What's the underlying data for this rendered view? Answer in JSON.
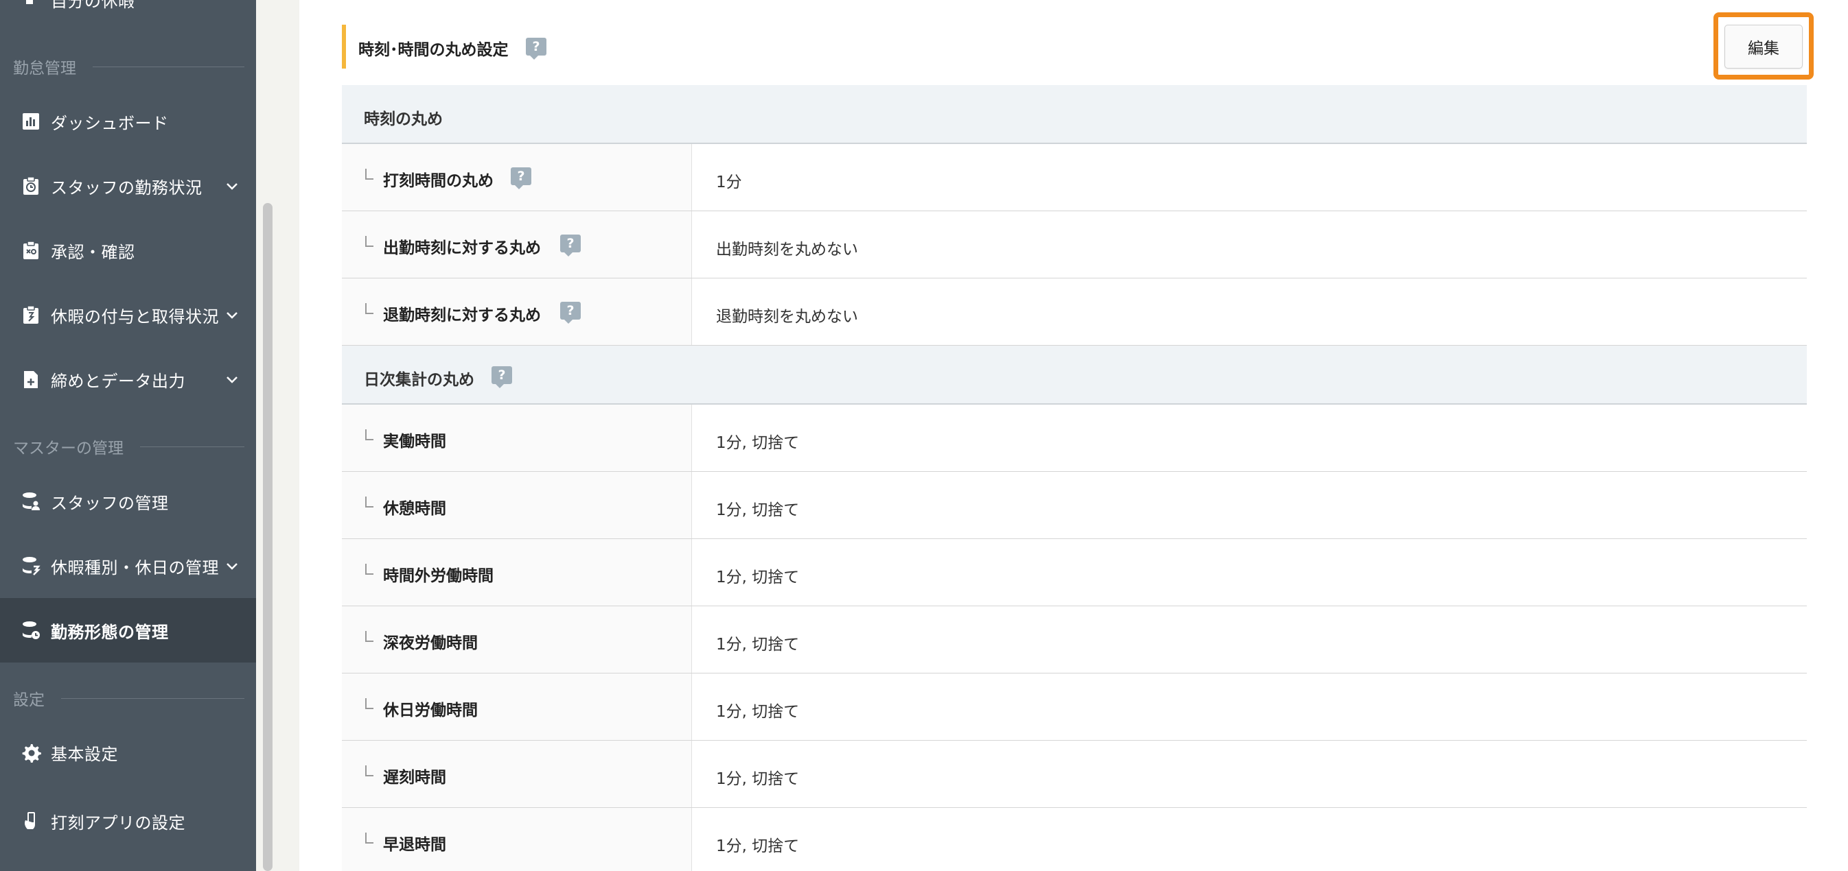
{
  "sidebar": {
    "top_partial_label": "自分の休暇",
    "sections": [
      {
        "label": "勤怠管理"
      },
      {
        "label": "マスターの管理"
      },
      {
        "label": "設定"
      }
    ],
    "items": [
      {
        "label": "ダッシュボード",
        "icon": "chart-icon"
      },
      {
        "label": "スタッフの勤務状況",
        "icon": "clock-clipboard-icon",
        "has_submenu": true
      },
      {
        "label": "承認・確認",
        "icon": "approval-clipboard-icon"
      },
      {
        "label": "休暇の付与と取得状況",
        "icon": "leave-clipboard-icon",
        "has_submenu": true
      },
      {
        "label": "締めとデータ出力",
        "icon": "file-export-icon",
        "has_submenu": true
      },
      {
        "label": "スタッフの管理",
        "icon": "database-user-icon"
      },
      {
        "label": "休暇種別・休日の管理",
        "icon": "database-leave-icon",
        "has_submenu": true
      },
      {
        "label": "勤務形態の管理",
        "icon": "database-clock-icon",
        "active": true
      },
      {
        "label": "基本設定",
        "icon": "gear-icon"
      },
      {
        "label": "打刻アプリの設定",
        "icon": "phone-hand-icon"
      }
    ]
  },
  "main": {
    "section_title": "時刻･時間の丸め設定",
    "help_glyph": "?",
    "edit_button_label": "編集",
    "groups": [
      {
        "title": "時刻の丸め",
        "rows": [
          {
            "label": "打刻時間の丸め",
            "value": "1分"
          },
          {
            "label": "出勤時刻に対する丸め",
            "value": "出勤時刻を丸めない"
          },
          {
            "label": "退勤時刻に対する丸め",
            "value": "退勤時刻を丸めない"
          }
        ]
      },
      {
        "title": "日次集計の丸め",
        "rows": [
          {
            "label": "実働時間",
            "value": "1分, 切捨て"
          },
          {
            "label": "休憩時間",
            "value": "1分, 切捨て"
          },
          {
            "label": "時間外労働時間",
            "value": "1分, 切捨て"
          },
          {
            "label": "深夜労働時間",
            "value": "1分, 切捨て"
          },
          {
            "label": "休日労働時間",
            "value": "1分, 切捨て"
          },
          {
            "label": "遅刻時間",
            "value": "1分, 切捨て"
          },
          {
            "label": "早退時間",
            "value": "1分, 切捨て"
          }
        ]
      }
    ]
  },
  "colors": {
    "sidebar_bg": "#4b5660",
    "sidebar_active_bg": "#3a434b",
    "section_accent": "#f5b73c",
    "highlight": "#f18a1c",
    "group_header_bg": "#eff3f6",
    "help_badge": "#a1b0bb"
  }
}
